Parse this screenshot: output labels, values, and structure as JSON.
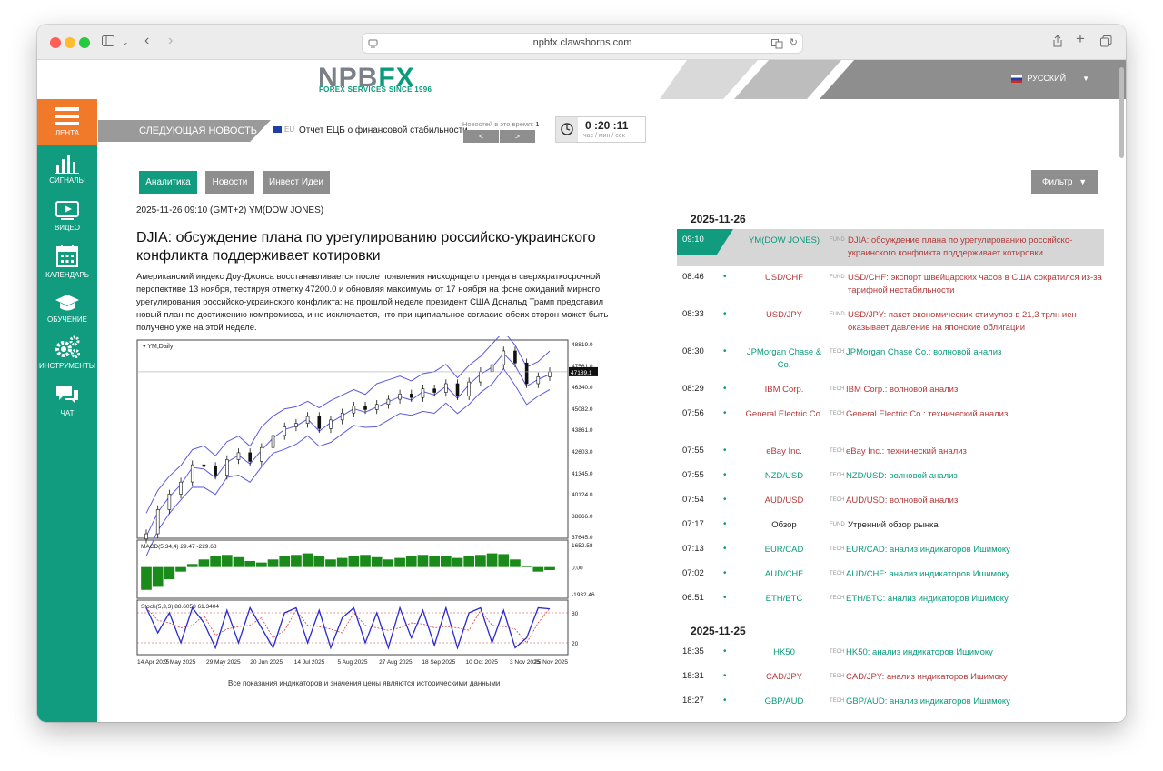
{
  "browser": {
    "url": "npbfx.clawshorns.com"
  },
  "site": {
    "logo_text_main": "NPB",
    "logo_text_fx": "FX",
    "logo_sub": "FOREX SERVICES SINCE 1996",
    "language": "РУССКИЙ"
  },
  "sidebar": {
    "items": [
      {
        "label": "ЛЕНТА",
        "icon": "list-icon"
      },
      {
        "label": "СИГНАЛЫ",
        "icon": "bar-chart-icon"
      },
      {
        "label": "ВИДЕО",
        "icon": "video-icon"
      },
      {
        "label": "КАЛЕНДАРЬ",
        "icon": "calendar-icon"
      },
      {
        "label": "ОБУЧЕНИЕ",
        "icon": "graduation-cap-icon"
      },
      {
        "label": "ИНСТРУМЕНТЫ",
        "icon": "gears-icon"
      },
      {
        "label": "ЧАТ",
        "icon": "chat-icon"
      }
    ]
  },
  "news_bar": {
    "next_label": "СЛЕДУЮЩАЯ НОВОСТЬ",
    "region": "EU",
    "event": "Отчет ЕЦБ о финансовой стабильности",
    "count_label": "Новостей в это время:",
    "count": "1",
    "prev": "<",
    "next": ">",
    "timer": "0 :20 :11",
    "timer_units": "час / мин / сек"
  },
  "tabs": [
    {
      "label": "Аналитика",
      "active": true
    },
    {
      "label": "Новости",
      "active": false
    },
    {
      "label": "Инвест Идеи",
      "active": false
    }
  ],
  "filter_label": "Фильтр",
  "article": {
    "date": "2025-11-26 09:10 (GMT+2) YM(DOW JONES)",
    "title": "DJIA: обсуждение плана по урегулированию российско-украинского конфликта поддерживает котировки",
    "body": "Американский индекс Доу-Джонса восстанавливается после появления нисходящего тренда в сверхкраткосрочной перспективе 13 ноября, тестируя отметку 47200.0 и обновляя максимумы от 17 ноября на фоне ожиданий мирного урегулирования российско-украинского конфликта: на прошлой неделе президент США Дональд Трамп представил новый план по достижению компромисса, и не исключается, что принципиальное согласие обеих сторон может быть получено уже на этой неделе.",
    "footnote": "Все показания индикаторов и значения цены являются историческими данными"
  },
  "chart_data": {
    "type": "line",
    "title": "YM,Daily",
    "price_ticks": [
      "48819.0",
      "47561.0",
      "46340.0",
      "45082.0",
      "43861.0",
      "42603.0",
      "41345.0",
      "40124.0",
      "38866.0",
      "37645.0"
    ],
    "current_price": "47189.1",
    "x_ticks": [
      "14 Apr 2025",
      "7 May 2025",
      "29 May 2025",
      "20 Jun 2025",
      "14 Jul 2025",
      "5 Aug 2025",
      "27 Aug 2025",
      "18 Sep 2025",
      "10 Oct 2025",
      "3 Nov 2025",
      "25 Nov 2025"
    ],
    "price": [
      37800,
      39200,
      40100,
      40800,
      41800,
      41700,
      41200,
      42100,
      42500,
      42000,
      42800,
      43500,
      44000,
      44200,
      44600,
      43900,
      44400,
      44800,
      45200,
      45000,
      45300,
      45600,
      45900,
      45700,
      46200,
      46000,
      46500,
      45800,
      46600,
      47200,
      47600,
      48400,
      47700,
      46500,
      46900,
      47189
    ],
    "macd_label": "MACD(5,34,4) 29.47 -229.68",
    "macd_ticks": [
      "1652.58",
      "0.00",
      "-1932.46"
    ],
    "macd": [
      -1500,
      -1300,
      -800,
      -300,
      200,
      500,
      700,
      800,
      650,
      400,
      300,
      500,
      700,
      800,
      900,
      700,
      500,
      600,
      700,
      800,
      650,
      500,
      600,
      700,
      800,
      750,
      700,
      600,
      700,
      800,
      900,
      850,
      500,
      100,
      -300,
      -200
    ],
    "stoch_label": "Stoch(5,3,3) 88.6058 61.3404",
    "stoch_ticks": [
      "80",
      "20"
    ],
    "stoch": [
      90,
      40,
      80,
      20,
      90,
      60,
      10,
      85,
      20,
      90,
      50,
      10,
      80,
      90,
      20,
      85,
      10,
      70,
      90,
      20,
      80,
      10,
      90,
      30,
      85,
      15,
      90,
      10,
      80,
      90,
      20,
      85,
      10,
      30,
      90,
      88
    ]
  },
  "feed": {
    "days": [
      {
        "date": "2025-11-26",
        "items": [
          {
            "time": "09:10",
            "symbol": "YM(DOW JONES)",
            "tag": "FUND",
            "title": "DJIA: обсуждение плана по урегулированию российско-украинского конфликта поддерживает котировки",
            "color": "red",
            "sym_color": "green",
            "highlight": true
          },
          {
            "time": "08:46",
            "symbol": "USD/CHF",
            "tag": "FUND",
            "title": "USD/CHF: экспорт швейцарских часов в США сократился из-за тарифной нестабильности",
            "color": "red",
            "sym_color": "red"
          },
          {
            "time": "08:33",
            "symbol": "USD/JPY",
            "tag": "FUND",
            "title": "USD/JPY: пакет экономических стимулов в 21,3 трлн иен оказывает давление на японские облигации",
            "color": "red",
            "sym_color": "red"
          },
          {
            "time": "08:30",
            "symbol": "JPMorgan Chase & Co.",
            "tag": "TECH",
            "title": "JPMorgan Chase Co.: волновой анализ",
            "color": "green",
            "sym_color": "green"
          },
          {
            "time": "08:29",
            "symbol": "IBM Corp.",
            "tag": "TECH",
            "title": "IBM Corp.: волновой анализ",
            "color": "red",
            "sym_color": "red"
          },
          {
            "time": "07:56",
            "symbol": "General Electric Co.",
            "tag": "TECH",
            "title": "General Electric Co.: технический анализ",
            "color": "red",
            "sym_color": "red"
          },
          {
            "time": "07:55",
            "symbol": "eBay Inc.",
            "tag": "TECH",
            "title": "eBay Inc.: технический анализ",
            "color": "red",
            "sym_color": "red"
          },
          {
            "time": "07:55",
            "symbol": "NZD/USD",
            "tag": "TECH",
            "title": "NZD/USD: волновой анализ",
            "color": "green",
            "sym_color": "green"
          },
          {
            "time": "07:54",
            "symbol": "AUD/USD",
            "tag": "TECH",
            "title": "AUD/USD: волновой анализ",
            "color": "red",
            "sym_color": "red"
          },
          {
            "time": "07:17",
            "symbol": "Обзор",
            "tag": "FUND",
            "title": "Утренний обзор рынка",
            "color": "dark",
            "sym_color": "dark"
          },
          {
            "time": "07:13",
            "symbol": "EUR/CAD",
            "tag": "TECH",
            "title": "EUR/CAD: анализ индикаторов Ишимоку",
            "color": "green",
            "sym_color": "green"
          },
          {
            "time": "07:02",
            "symbol": "AUD/CHF",
            "tag": "TECH",
            "title": "AUD/CHF: анализ индикаторов Ишимоку",
            "color": "green",
            "sym_color": "green"
          },
          {
            "time": "06:51",
            "symbol": "ETH/BTC",
            "tag": "TECH",
            "title": "ETH/BTC: анализ индикаторов Ишимоку",
            "color": "green",
            "sym_color": "green"
          }
        ]
      },
      {
        "date": "2025-11-25",
        "items": [
          {
            "time": "18:35",
            "symbol": "HK50",
            "tag": "TECH",
            "title": "HK50: анализ индикаторов Ишимоку",
            "color": "green",
            "sym_color": "green"
          },
          {
            "time": "18:31",
            "symbol": "CAD/JPY",
            "tag": "TECH",
            "title": "CAD/JPY: анализ индикаторов Ишимоку",
            "color": "red",
            "sym_color": "red"
          },
          {
            "time": "18:27",
            "symbol": "GBP/AUD",
            "tag": "TECH",
            "title": "GBP/AUD: анализ индикаторов Ишимоку",
            "color": "green",
            "sym_color": "green"
          }
        ]
      }
    ]
  },
  "colors": {
    "brand_green": "#119b7f",
    "active_orange": "#f07a2a",
    "header_gray": "#8e8e8e",
    "link_red": "#b33a3a",
    "link_green": "#0a9a7c"
  }
}
